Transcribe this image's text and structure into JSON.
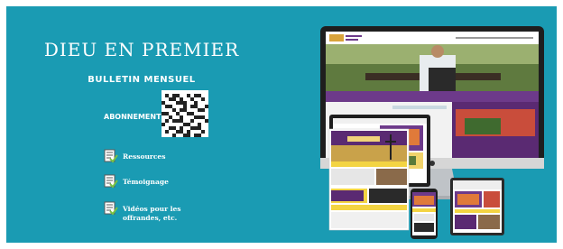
{
  "heading": "DIEU EN PREMIER",
  "subheading": "BULLETIN MENSUEL",
  "subscribe_label": "ABONNEMENT",
  "links": [
    {
      "label": "Ressources",
      "icon": "checklist-icon"
    },
    {
      "label": "Témoignage",
      "icon": "checklist-icon"
    },
    {
      "label": "Vidéos pour les offrandes, etc.",
      "icon": "checklist-icon"
    }
  ],
  "colors": {
    "banner": "#1a9bb3",
    "text": "#ffffff"
  }
}
